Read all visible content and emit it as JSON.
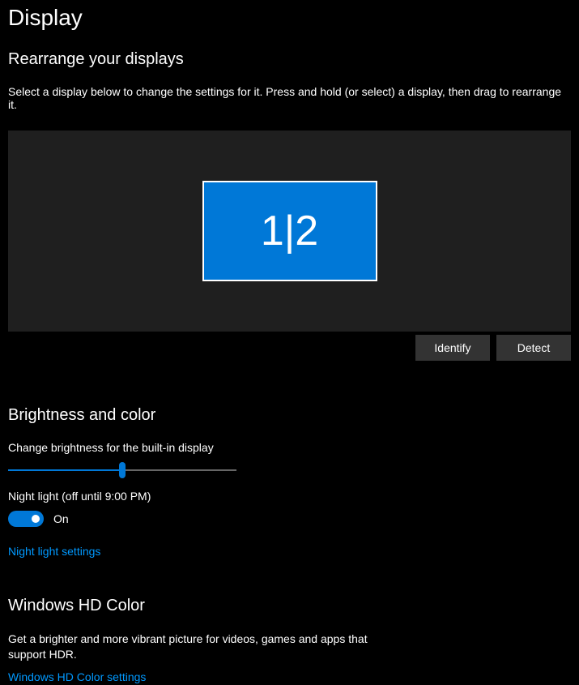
{
  "page_title": "Display",
  "rearrange": {
    "title": "Rearrange your displays",
    "instruction": "Select a display below to change the settings for it. Press and hold (or select) a display, then drag to rearrange it.",
    "display_label": "1|2",
    "identify_label": "Identify",
    "detect_label": "Detect"
  },
  "brightness": {
    "title": "Brightness and color",
    "slider_label": "Change brightness for the built-in display",
    "slider_percent": 50,
    "night_light_label": "Night light (off until 9:00 PM)",
    "toggle_state": "On",
    "night_light_settings": "Night light settings"
  },
  "hd_color": {
    "title": "Windows HD Color",
    "description": "Get a brighter and more vibrant picture for videos, games and apps that support HDR.",
    "link": "Windows HD Color settings"
  },
  "colors": {
    "accent": "#0078d7",
    "link": "#0099ff"
  }
}
